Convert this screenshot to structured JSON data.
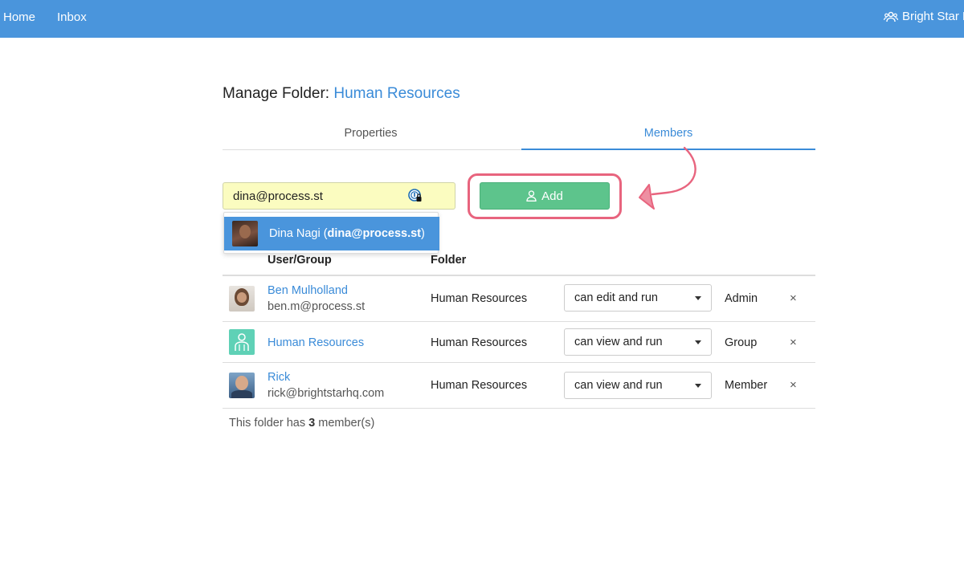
{
  "nav": {
    "home": "Home",
    "inbox": "Inbox",
    "org_name": "Bright Star M",
    "org_icon": "users-icon"
  },
  "title": {
    "prefix": "Manage Folder:",
    "folder_name": "Human Resources"
  },
  "tabs": [
    {
      "label": "Properties",
      "active": false
    },
    {
      "label": "Members",
      "active": true
    }
  ],
  "add_member": {
    "input_value": "dina@process.st",
    "button_label": "Add",
    "button_icon": "user-icon"
  },
  "suggestion": {
    "name": "Dina Nagi",
    "email": "dina@process.st",
    "open_paren": " (",
    "close_paren": ")"
  },
  "table": {
    "headers": {
      "user": "User/Group",
      "folder": "Folder"
    },
    "rows": [
      {
        "name": "Ben Mulholland",
        "email": "ben.m@process.st",
        "folder": "Human Resources",
        "permission": "can edit and run",
        "role": "Admin",
        "remove": "×"
      },
      {
        "name": "Human Resources",
        "email": "",
        "folder": "Human Resources",
        "permission": "can view and run",
        "role": "Group",
        "remove": "×"
      },
      {
        "name": "Rick",
        "email": "rick@brightstarhq.com",
        "folder": "Human Resources",
        "permission": "can view and run",
        "role": "Member",
        "remove": "×"
      }
    ]
  },
  "footer": {
    "prefix": "This folder has ",
    "count": "3",
    "suffix": " member(s)"
  },
  "colors": {
    "nav_bg": "#4a95dc",
    "accent": "#3a8bd8",
    "add_button": "#5dc48c",
    "highlight": "#e8647e",
    "input_bg": "#fbfcc0"
  }
}
